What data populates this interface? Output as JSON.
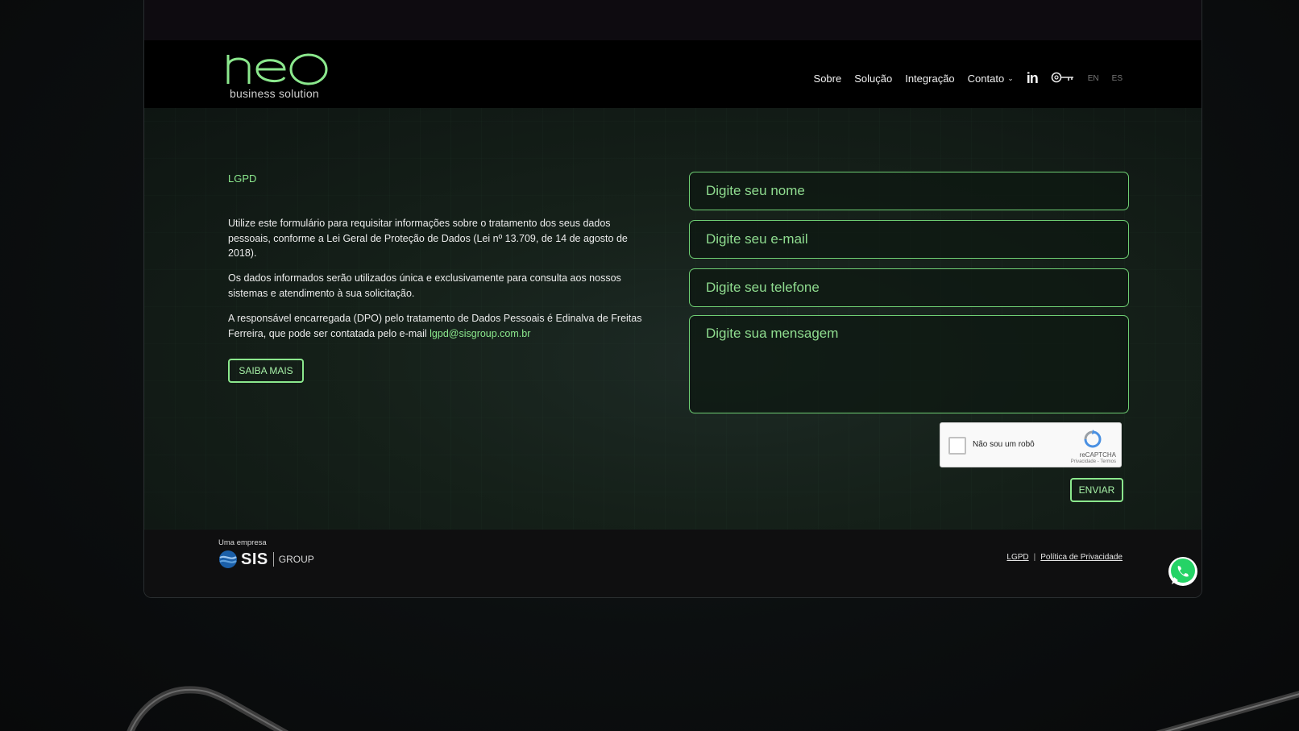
{
  "brand": {
    "logo_wordmark": "neo",
    "logo_sub": "business solution",
    "accent_color": "#8be88d"
  },
  "nav": {
    "items": [
      "Sobre",
      "Solução",
      "Integração",
      "Contato"
    ],
    "social_icon": "linkedin-icon",
    "key_icon": "key-icon",
    "languages": [
      "EN",
      "ES"
    ]
  },
  "content": {
    "section_title": "LGPD",
    "paragraph1": "Utilize este formulário para requisitar informações sobre o tratamento dos seus dados pessoais, conforme a Lei Geral de Proteção de Dados (Lei nº 13.709, de 14 de agosto de 2018).",
    "paragraph2": "Os dados informados serão utilizados única e exclusivamente para consulta aos nossos sistemas e atendimento à sua solicitação.",
    "paragraph3_prefix": "A responsável encarregada (DPO) pelo tratamento de Dados Pessoais é Edinalva de Freitas Ferreira, que pode ser contatada pelo e-mail ",
    "email": "lgpd@sisgroup.com.br",
    "saiba_label": "SAIBA MAIS"
  },
  "form": {
    "name_placeholder": "Digite seu nome",
    "email_placeholder": "Digite seu e-mail",
    "phone_placeholder": "Digite seu telefone",
    "message_placeholder": "Digite sua mensagem",
    "captcha_label": "Não sou um robô",
    "captcha_brand": "reCAPTCHA",
    "captcha_terms": "Privacidade - Termos",
    "submit_label": "ENVIAR"
  },
  "footer": {
    "company_caption": "Uma empresa",
    "company_name": "SIS",
    "company_group": "GROUP",
    "links": [
      "LGPD",
      "Política de Privacidade"
    ]
  }
}
